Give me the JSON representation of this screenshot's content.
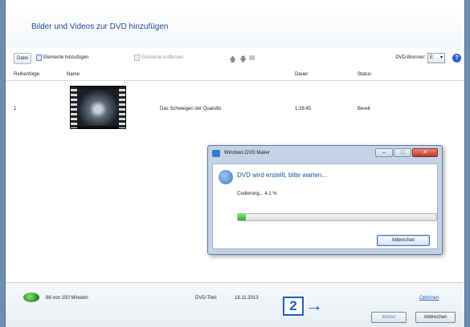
{
  "header": {
    "title": "Bilder und Videos zur DVD hinzufügen"
  },
  "toolbar": {
    "file_label": "Datei",
    "add_items_label": "Elemente hinzufügen",
    "remove_items_label": "Elemente entfernen",
    "burner_label": "DVD-Brenner:",
    "burner_value": "E:",
    "icons": [
      "add-items-icon",
      "remove-items-icon",
      "move-up-icon",
      "move-down-icon",
      "properties-icon",
      "help-icon"
    ]
  },
  "table": {
    "columns": [
      "Reihenfolge",
      "Name",
      "Dauer",
      "Status"
    ],
    "rows": [
      {
        "order": "1",
        "name": "Das Schweigen der Quandts",
        "duration": "1:28:45",
        "status": "Bereit"
      }
    ]
  },
  "footer": {
    "capacity": "88 von 150 Minuten",
    "date_label": "DVD-Titel:",
    "date_value": "18.11.2013",
    "options_link": "Optionen",
    "next_button": "Weiter",
    "cancel_button": "Abbrechen"
  },
  "callout": {
    "number": "2"
  },
  "dialog": {
    "title": "Windows DVD Maker",
    "heading": "DVD wird erstellt, bitte warten...",
    "status": "Codierung... 4.1 %",
    "progress_fraction": 0.041,
    "cancel_button": "Abbrechen",
    "window_controls": [
      "minimize-icon",
      "maximize-icon",
      "close-icon"
    ]
  },
  "colors": {
    "accent": "#1d4f91",
    "progress": "#2fae2a",
    "callout": "#1e63b8"
  }
}
